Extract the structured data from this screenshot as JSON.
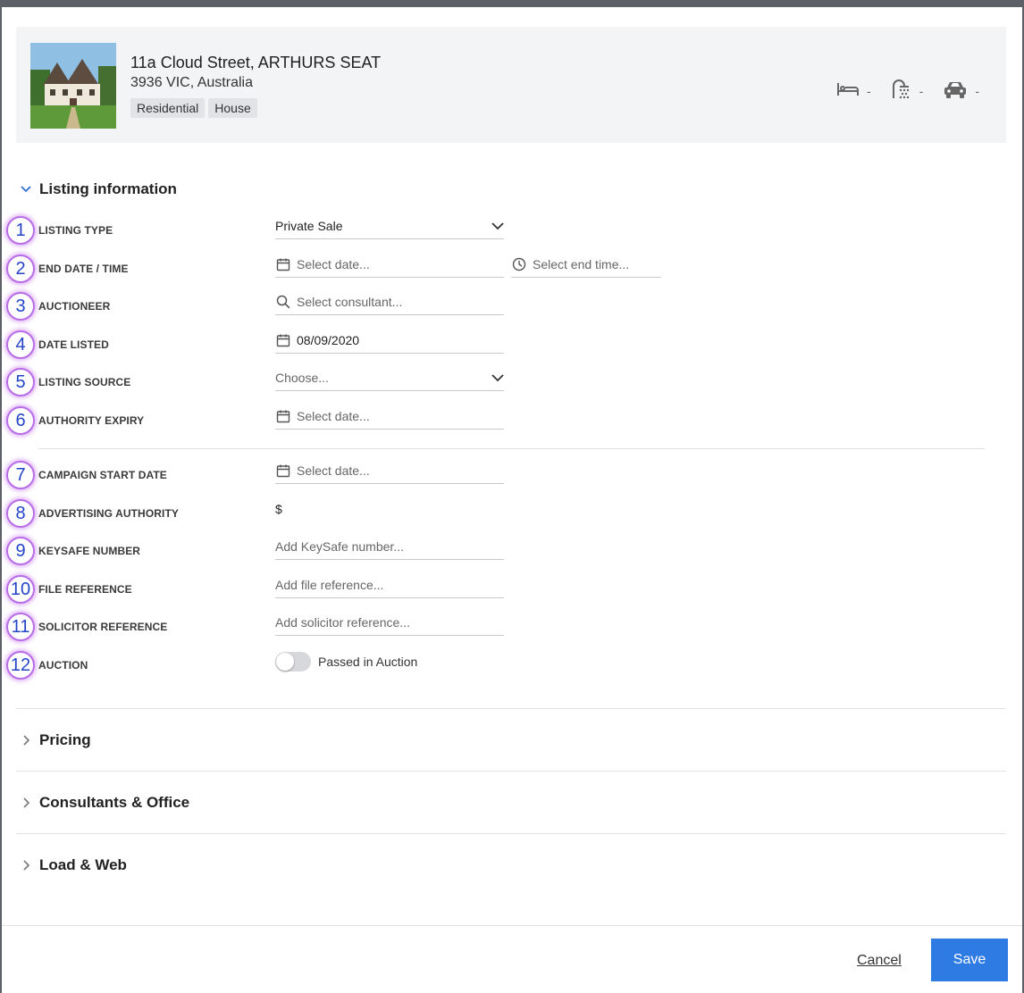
{
  "property": {
    "title": "11a Cloud Street, ARTHURS SEAT",
    "subtitle": "3936 VIC, Australia",
    "tags": [
      "Residential",
      "House"
    ],
    "stats": {
      "bedrooms": "-",
      "bathrooms": "-",
      "parking": "-"
    }
  },
  "sections": {
    "listing_information": "Listing information",
    "pricing": "Pricing",
    "consultants_office": "Consultants & Office",
    "load_web": "Load & Web"
  },
  "rows": [
    {
      "num": "1",
      "label": "LISTING TYPE",
      "value": "Private Sale"
    },
    {
      "num": "2",
      "label": "END DATE / TIME",
      "date_placeholder": "Select date...",
      "time_placeholder": "Select end time..."
    },
    {
      "num": "3",
      "label": "AUCTIONEER",
      "placeholder": "Select consultant..."
    },
    {
      "num": "4",
      "label": "DATE LISTED",
      "value": "08/09/2020"
    },
    {
      "num": "5",
      "label": "LISTING SOURCE",
      "placeholder": "Choose..."
    },
    {
      "num": "6",
      "label": "AUTHORITY EXPIRY",
      "placeholder": "Select date..."
    },
    {
      "num": "7",
      "label": "CAMPAIGN START DATE",
      "placeholder": "Select date..."
    },
    {
      "num": "8",
      "label": "ADVERTISING AUTHORITY",
      "value": "$"
    },
    {
      "num": "9",
      "label": "KEYSAFE NUMBER",
      "placeholder": "Add KeySafe number..."
    },
    {
      "num": "10",
      "label": "FILE REFERENCE",
      "placeholder": "Add file reference..."
    },
    {
      "num": "11",
      "label": "SOLICITOR REFERENCE",
      "placeholder": "Add solicitor reference..."
    },
    {
      "num": "12",
      "label": "AUCTION",
      "toggle_label": "Passed in Auction",
      "toggle_on": false
    }
  ],
  "footer": {
    "cancel_label": "Cancel",
    "save_label": "Save"
  },
  "colors": {
    "primary": "#2f7be4",
    "badge_ring": "#b86de6",
    "badge_text": "#2445c8"
  }
}
